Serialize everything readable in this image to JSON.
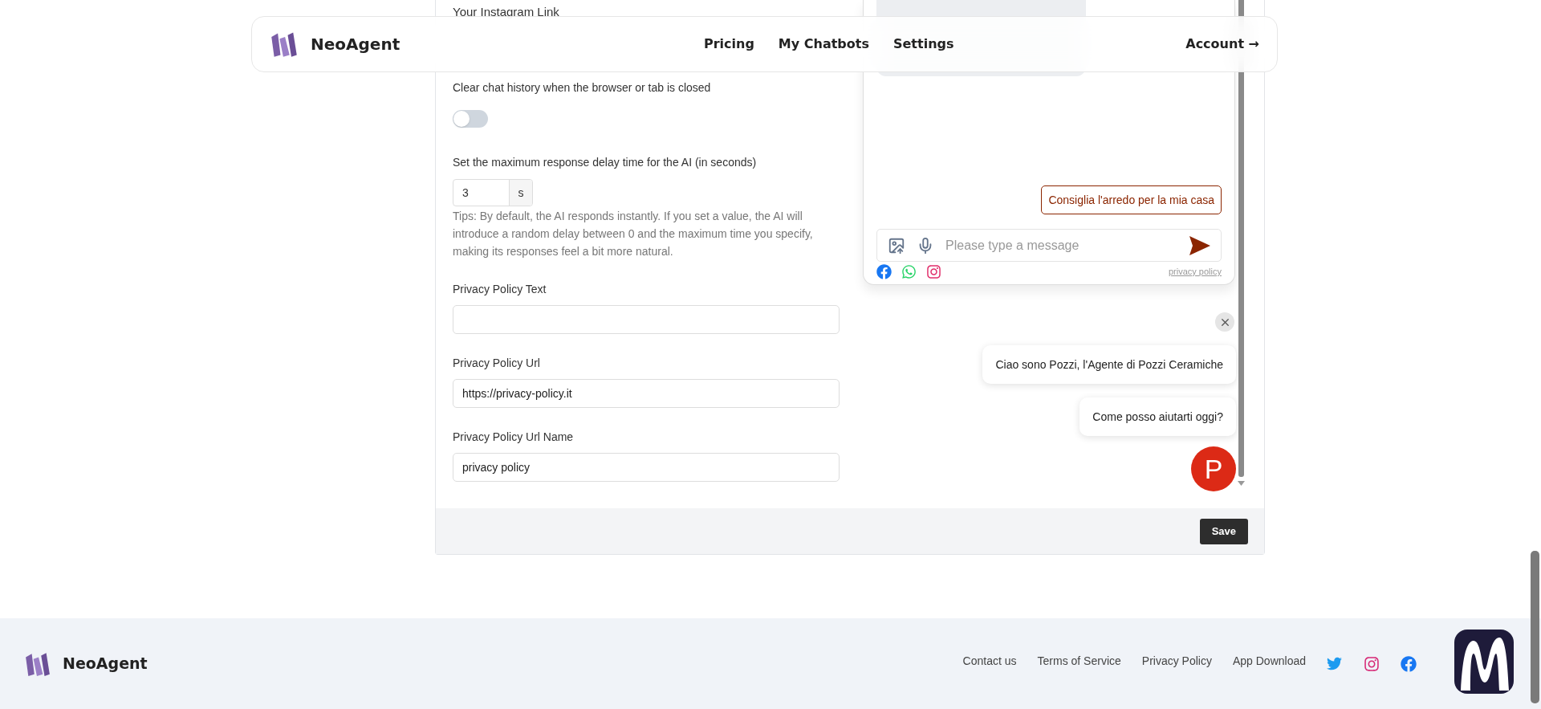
{
  "navbar": {
    "brand": "NeoAgent",
    "links": [
      {
        "label": "Pricing"
      },
      {
        "label": "My Chatbots"
      },
      {
        "label": "Settings"
      }
    ],
    "account": "Account →"
  },
  "form": {
    "instagram_label": "Your Instagram Link",
    "clear_history": {
      "label": "Clear chat history when the browser or tab is closed",
      "on": false
    },
    "delay": {
      "label": "Set the maximum response delay time for the AI (in seconds)",
      "value": "3",
      "unit": "s",
      "tips": "Tips: By default, the AI responds instantly. If you set a value, the AI will introduce a random delay between 0 and the maximum time you specify, making its responses feel a bit more natural."
    },
    "fields": [
      {
        "label": "Privacy Policy Text"
      },
      {
        "label": "Privacy Policy Url",
        "value": "https://privacy-policy.it"
      },
      {
        "label": "Privacy Policy Url Name",
        "value": "privacy policy"
      }
    ]
  },
  "chat_preview": {
    "suggestion": "Consiglia l'arredo per la mia casa",
    "input_placeholder": "Please type a message",
    "privacy_link": "privacy policy"
  },
  "widget": {
    "messages": [
      "Ciao sono Pozzi, l'Agente di Pozzi Ceramiche",
      "Come posso aiutarti oggi?"
    ],
    "avatar_letter": "P"
  },
  "save_button": "Save",
  "footer": {
    "brand": "NeoAgent",
    "links": [
      "Contact us",
      "Terms of Service",
      "Privacy Policy",
      "App Download"
    ]
  }
}
